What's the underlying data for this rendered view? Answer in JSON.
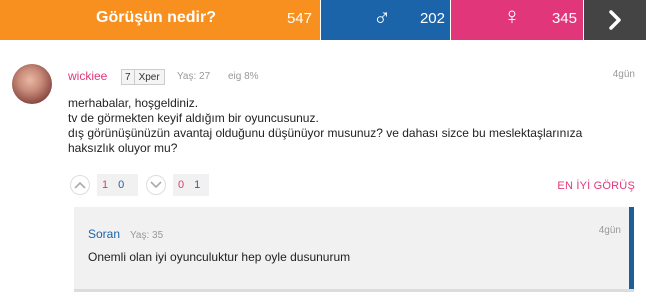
{
  "header": {
    "question": "Görüşün nedir?",
    "total_count": "547",
    "male_count": "202",
    "female_count": "345",
    "male_symbol": "♂",
    "female_symbol": "♀"
  },
  "post": {
    "username": "wickiee",
    "level": "7",
    "rank": "Xper",
    "age": "Yaş: 27",
    "eig": "eig 8%",
    "time": "4gün",
    "lines": [
      "merhabalar, hoşgeldiniz.",
      "tv de görmekten keyif aldığım bir oyuncusunuz.",
      "dış görünüşünüzün avantaj olduğunu düşünüyor musunuz? ve dahası sizce bu meslektaşlarınıza",
      "haksızlık oluyor mu?"
    ],
    "votes_up": {
      "positive": "1",
      "negative": "0"
    },
    "votes_down": {
      "positive": "0",
      "negative": "1"
    },
    "best_answer_label": "EN İYİ GÖRÜŞ"
  },
  "reply": {
    "username": "Soran",
    "age": "Yaş: 35",
    "time": "4gün",
    "text": "Onemli olan iyi oyunculuktur hep oyle dusunurum"
  },
  "colors": {
    "orange": "#f7901e",
    "male_blue": "#1b64a9",
    "female_pink": "#e2367a",
    "dark": "#444444"
  },
  "icons": {
    "next": "chevron-right-icon",
    "vote_up": "chevron-up-icon",
    "vote_down": "chevron-down-icon"
  }
}
